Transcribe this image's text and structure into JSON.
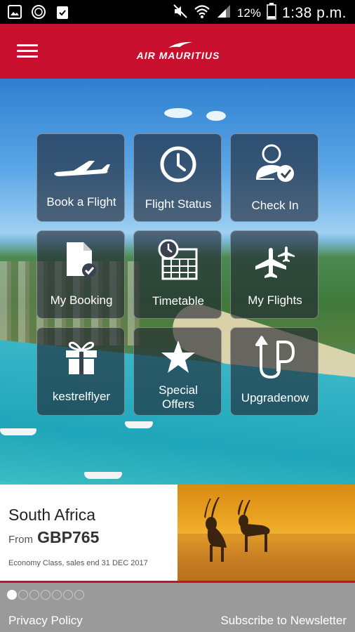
{
  "status_bar": {
    "battery_percent": "12%",
    "time": "1:38 p.m."
  },
  "app_bar": {
    "logo_text": "AIR MAURITIUS"
  },
  "tiles": [
    {
      "label": "Book a Flight",
      "icon": "airplane-icon"
    },
    {
      "label": "Flight Status",
      "icon": "clock-icon"
    },
    {
      "label": "Check In",
      "icon": "user-check-icon"
    },
    {
      "label": "My Booking",
      "icon": "document-check-icon"
    },
    {
      "label": "Timetable",
      "icon": "calendar-clock-icon"
    },
    {
      "label": "My Flights",
      "icon": "two-planes-icon"
    },
    {
      "label": "kestrelflyer",
      "icon": "gift-icon"
    },
    {
      "label": "Special\nOffers",
      "icon": "star-icon"
    },
    {
      "label": "Upgradenow",
      "icon": "upgrade-icon"
    }
  ],
  "promo": {
    "destination": "South Africa",
    "from_label": "From",
    "price": "GBP765",
    "fine_print": "Economy Class, sales end 31 DEC 2017"
  },
  "carousel": {
    "count": 7,
    "active_index": 0
  },
  "footer": {
    "privacy_label": "Privacy Policy",
    "newsletter_label": "Subscribe to Newsletter"
  },
  "colors": {
    "brand_red": "#c8102e",
    "footer_gray": "#9a9a9a"
  }
}
